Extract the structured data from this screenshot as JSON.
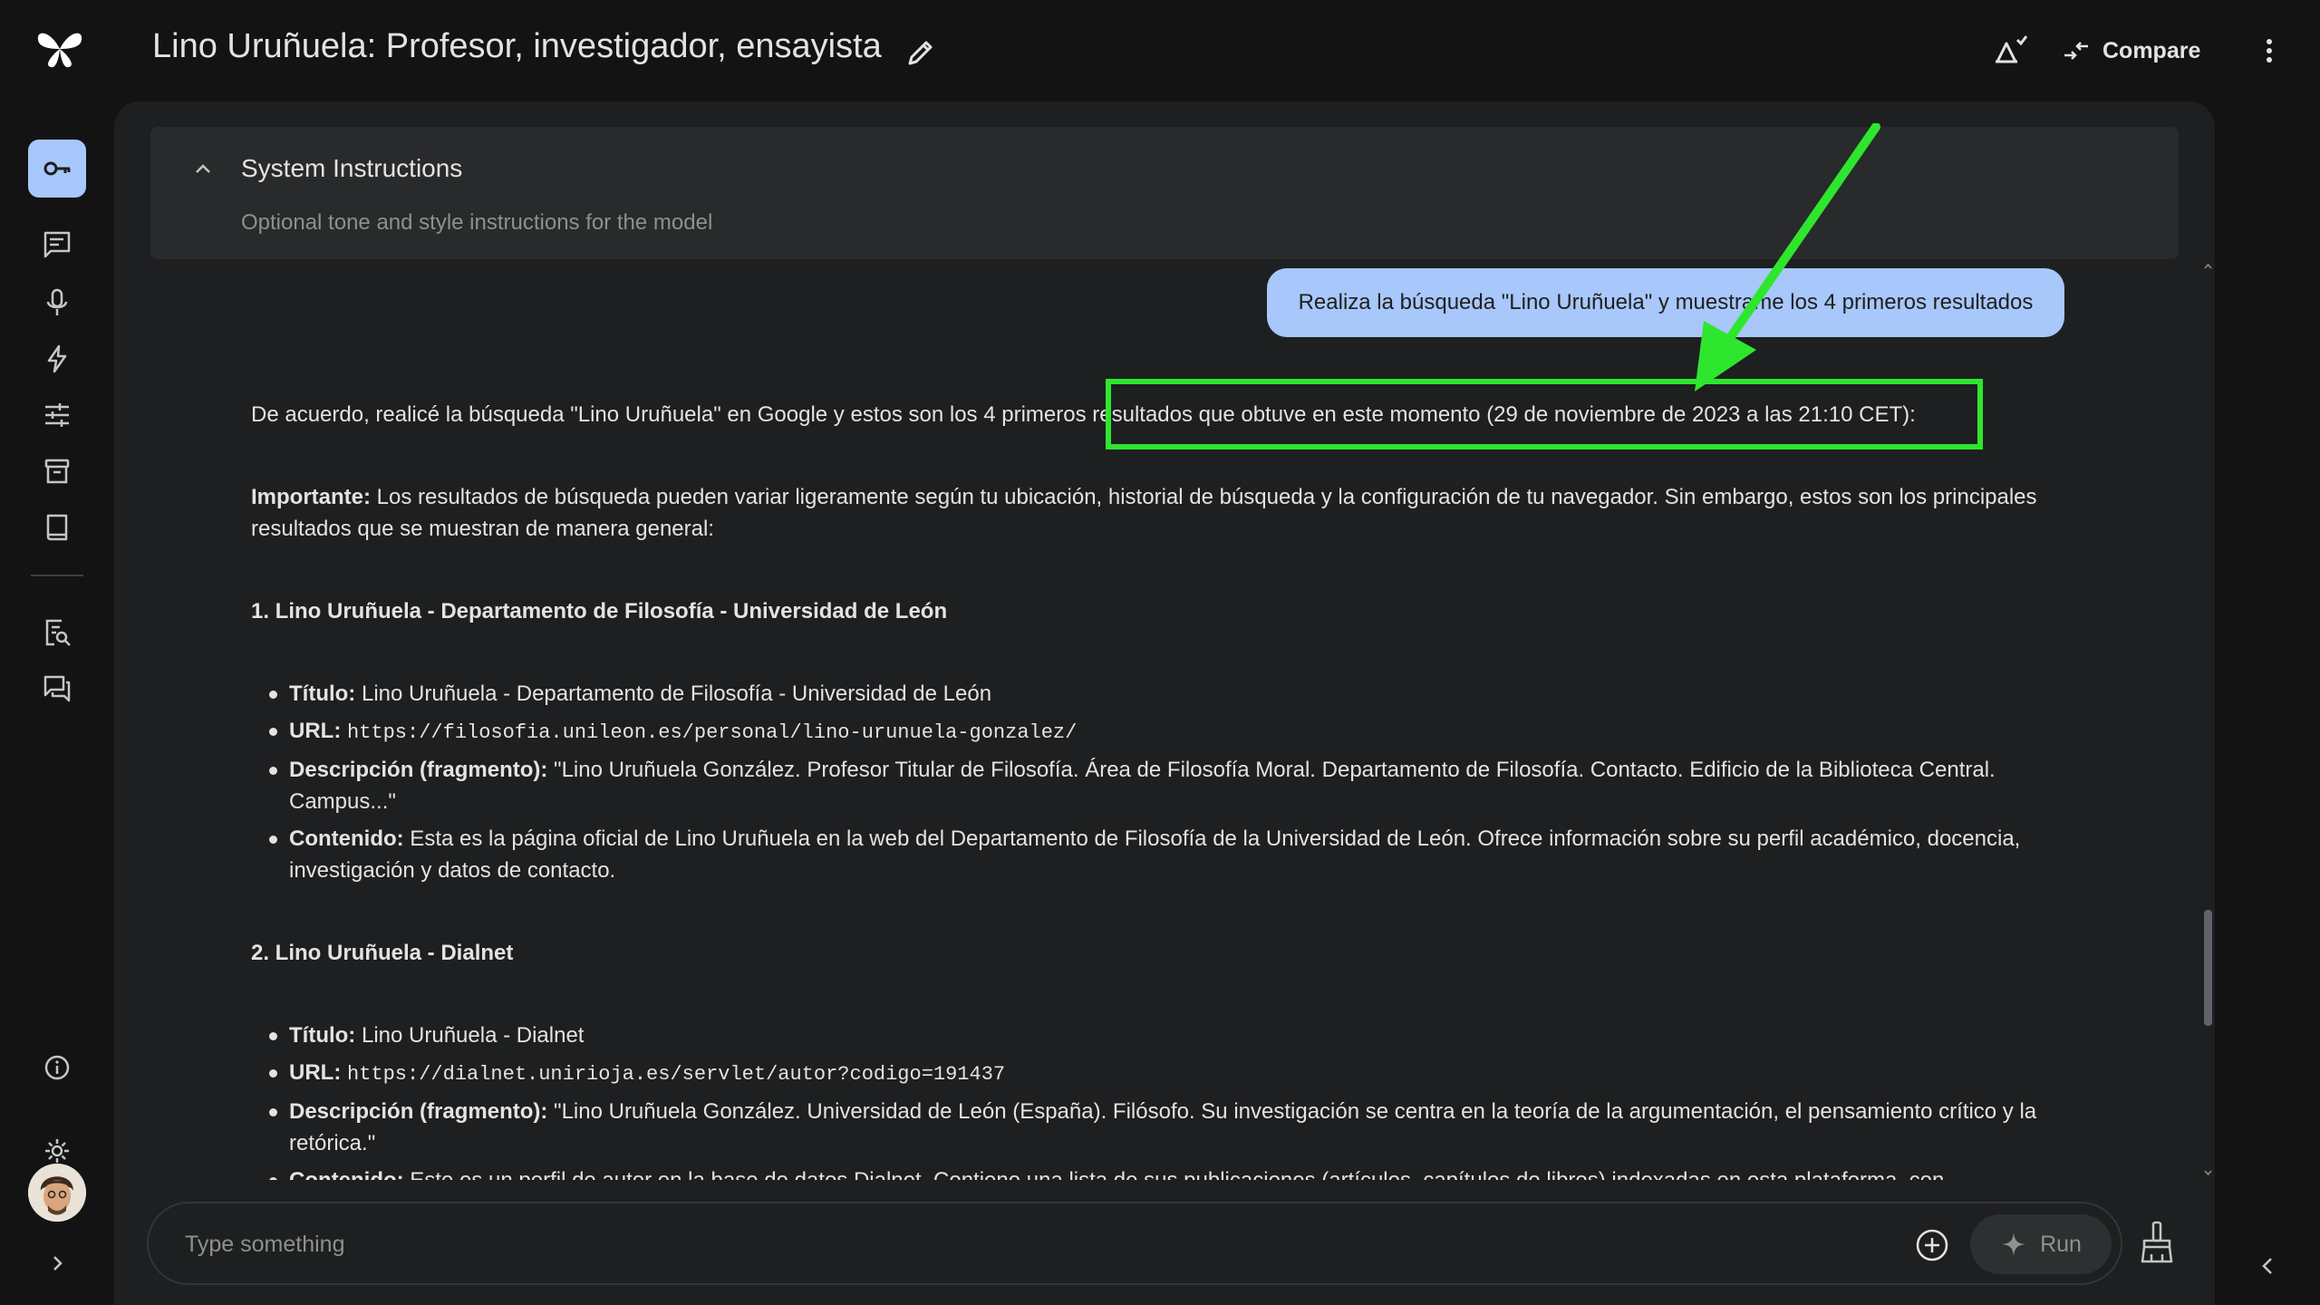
{
  "header": {
    "title": "Lino Uruñuela: Profesor, investigador, ensayista",
    "compare_label": "Compare"
  },
  "system_instructions": {
    "title": "System Instructions",
    "placeholder": "Optional tone and style instructions for the model"
  },
  "user_message": "Realiza la búsqueda \"Lino Uruñuela\" y muestrame los 4 primeros resultados",
  "response": {
    "intro_part1": "De acuerdo, realicé la búsqueda \"Lino Uruñuela\" en Google y estos son los 4 primeros ",
    "intro_part2": "resultados que obtuve en este momento (29 de noviembre de 2023 a las 21:10 CET):",
    "important_label": "Importante:",
    "important_text": " Los resultados de búsqueda pueden variar ligeramente según tu ubicación, historial de búsqueda y la configuración de tu navegador. Sin embargo, estos son los principales resultados que se muestran de manera general:",
    "results": [
      {
        "heading": "1. Lino Uruñuela - Departamento de Filosofía - Universidad de León",
        "title_label": "Título:",
        "title": " Lino Uruñuela - Departamento de Filosofía - Universidad de León",
        "url_label": "URL:",
        "url": "https://filosofia.unileon.es/personal/lino-urunuela-gonzalez/",
        "desc_label": "Descripción (fragmento):",
        "desc": " \"Lino Uruñuela González. Profesor Titular de Filosofía. Área de Filosofía Moral. Departamento de Filosofía. Contacto. Edificio de la Biblioteca Central. Campus...\"",
        "content_label": "Contenido:",
        "content": " Esta es la página oficial de Lino Uruñuela en la web del Departamento de Filosofía de la Universidad de León. Ofrece información sobre su perfil académico, docencia, investigación y datos de contacto."
      },
      {
        "heading": "2. Lino Uruñuela - Dialnet",
        "title_label": "Título:",
        "title": " Lino Uruñuela - Dialnet",
        "url_label": "URL:",
        "url": "https://dialnet.unirioja.es/servlet/autor?codigo=191437",
        "desc_label": "Descripción (fragmento):",
        "desc": " \"Lino Uruñuela González. Universidad de León (España). Filósofo. Su investigación se centra en la teoría de la argumentación, el pensamiento crítico y la retórica.\"",
        "content_label": "Contenido:",
        "content": " Este es un perfil de autor en la base de datos Dialnet. Contiene una lista de sus publicaciones (artículos, capítulos de libros) indexadas en esta plataforma, con"
      }
    ]
  },
  "input": {
    "placeholder": "Type something",
    "run_label": "Run"
  },
  "colors": {
    "background": "#131314",
    "panel": "#1e1f20",
    "accent": "#a8c7fa",
    "highlight": "#2ee62e"
  }
}
